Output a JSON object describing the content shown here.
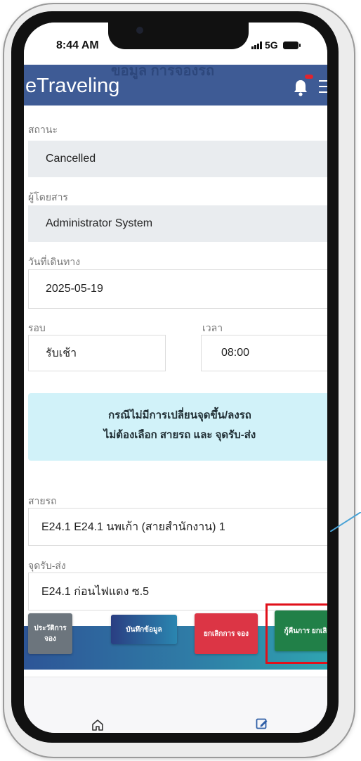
{
  "status_bar": {
    "time": "8:44 AM",
    "network": "5G"
  },
  "header": {
    "page_title": "ขอมูล การจองรถ",
    "brand": "eTraveling",
    "colors": {
      "header_bg": "#3e5b95",
      "notification_dot": "#e0242f"
    },
    "icons": [
      "bell-icon",
      "hamburger-menu-icon"
    ]
  },
  "form": {
    "status": {
      "label": "สถานะ",
      "value": "Cancelled"
    },
    "passenger": {
      "label": "ผู้โดยสาร",
      "value": "Administrator  System"
    },
    "travel_date": {
      "label": "วันที่เดินทาง",
      "value": "2025-05-19"
    },
    "round": {
      "label": "รอบ",
      "value": "รับเช้า"
    },
    "time": {
      "label": "เวลา",
      "value": "08:00"
    },
    "notice": {
      "line1": "กรณีไม่มีการเปลี่ยนจุดขึ้น/ลงรถ",
      "line2": "ไม่ต้องเลือก สายรถ และ จุดรับ-ส่ง"
    },
    "route": {
      "label": "สายรถ",
      "value": "E24.1 E24.1 นพเก้า (สายสำนักงาน) 1"
    },
    "pickup_point": {
      "label": "จุดรับ-ส่ง",
      "value": "E24.1 ก่อนไฟแดง ซ.5"
    }
  },
  "actions": {
    "history": "ประวัติการ จอง",
    "save": "บันทึกข้อมูล",
    "cancel": "ยกเลิกการ จอง",
    "restore": "กู้คืนการ ยกเลิก",
    "colors": {
      "history": "#6c757d",
      "cancel": "#dc3545",
      "restore": "#218048",
      "highlight": "#e0101a"
    }
  },
  "bottom_nav": {
    "icons": [
      "home-icon",
      "edit-icon"
    ]
  }
}
